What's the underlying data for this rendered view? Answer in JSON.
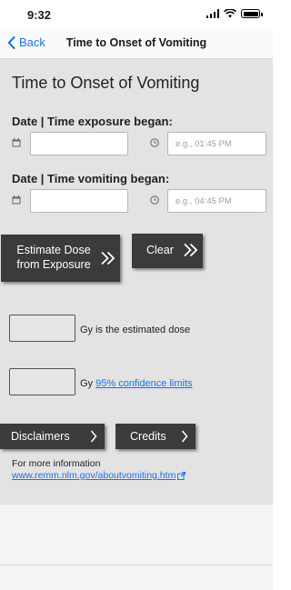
{
  "status_bar": {
    "time": "9:32",
    "icons": [
      "signal-icon",
      "wifi-icon",
      "battery-icon"
    ]
  },
  "nav": {
    "back_label": "Back",
    "title": "Time to Onset of Vomiting"
  },
  "page": {
    "title": "Time to Onset of Vomiting"
  },
  "exposure": {
    "label": "Date | Time exposure began:",
    "date_value": "",
    "time_placeholder": "e.g., 01:45 PM"
  },
  "vomiting": {
    "label": "Date | Time vomiting began:",
    "date_value": "",
    "time_placeholder": "e.g., 04:45 PM"
  },
  "buttons": {
    "estimate_line1": "Estimate Dose",
    "estimate_line2": "from Exposure",
    "clear": "Clear",
    "disclaimers": "Disclaimers",
    "credits": "Credits"
  },
  "results": {
    "dose_value": "",
    "dose_unit_text": "Gy is the estimated dose",
    "limits_value": "",
    "limits_unit": "Gy",
    "limits_link": "95% confidence limits"
  },
  "footer": {
    "more_info": "For more information",
    "link": "www.remm.nlm.gov/aboutvomiting.htm"
  },
  "colors": {
    "accent": "#1a73e8",
    "button_bg": "#3b3b3b",
    "panel_bg": "#e3e3e3"
  }
}
